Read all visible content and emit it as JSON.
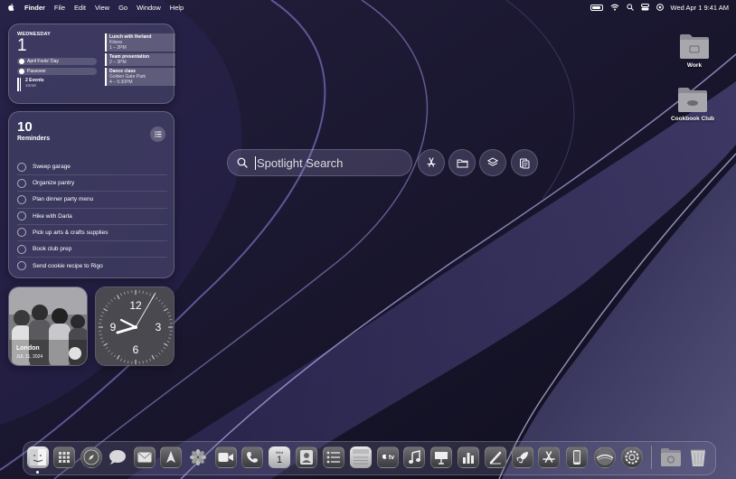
{
  "menubar": {
    "app_name": "Finder",
    "menus": [
      "File",
      "Edit",
      "View",
      "Go",
      "Window",
      "Help"
    ],
    "datetime": "Wed Apr 1  9:41 AM"
  },
  "calendar_widget": {
    "weekday": "WEDNESDAY",
    "day": "1",
    "all_day": [
      "April Fools' Day",
      "Passover"
    ],
    "more_events": "2 Events",
    "more_time": "10AM",
    "events": [
      {
        "title": "Lunch with Herland",
        "location": "Kitava",
        "time": "1 – 2PM"
      },
      {
        "title": "Team presentation",
        "location": "",
        "time": "2 – 3PM"
      },
      {
        "title": "Dance class",
        "location": "Golden Gate Park",
        "time": "4 – 5:30PM"
      }
    ]
  },
  "reminders_widget": {
    "count": "10",
    "title": "Reminders",
    "items": [
      "Sweep garage",
      "Organize pantry",
      "Plan dinner party menu",
      "Hike with Darla",
      "Pick up arts & crafts supplies",
      "Book club prep",
      "Send cookie recipe to Rigo"
    ]
  },
  "photos_widget": {
    "city": "London",
    "date": "JUL 11, 2024"
  },
  "clock_widget": {
    "numerals": [
      "12",
      "3",
      "6",
      "9"
    ]
  },
  "spotlight": {
    "placeholder": "Spotlight Search"
  },
  "desktop_folders": [
    {
      "label": "Work"
    },
    {
      "label": "Cookbook Club"
    }
  ],
  "dock": {
    "calendar_month": "Wed",
    "calendar_day": "1",
    "tv_label": "tv",
    "items": [
      "finder",
      "launchpad",
      "safari",
      "messages",
      "mail",
      "maps",
      "photos",
      "facetime",
      "phone",
      "calendar",
      "contacts",
      "reminders",
      "notes",
      "tv",
      "music",
      "keynote",
      "numbers",
      "pages",
      "xcode",
      "app-store",
      "iphone-mirroring",
      "system-settings",
      "settings",
      "downloads",
      "trash"
    ]
  }
}
